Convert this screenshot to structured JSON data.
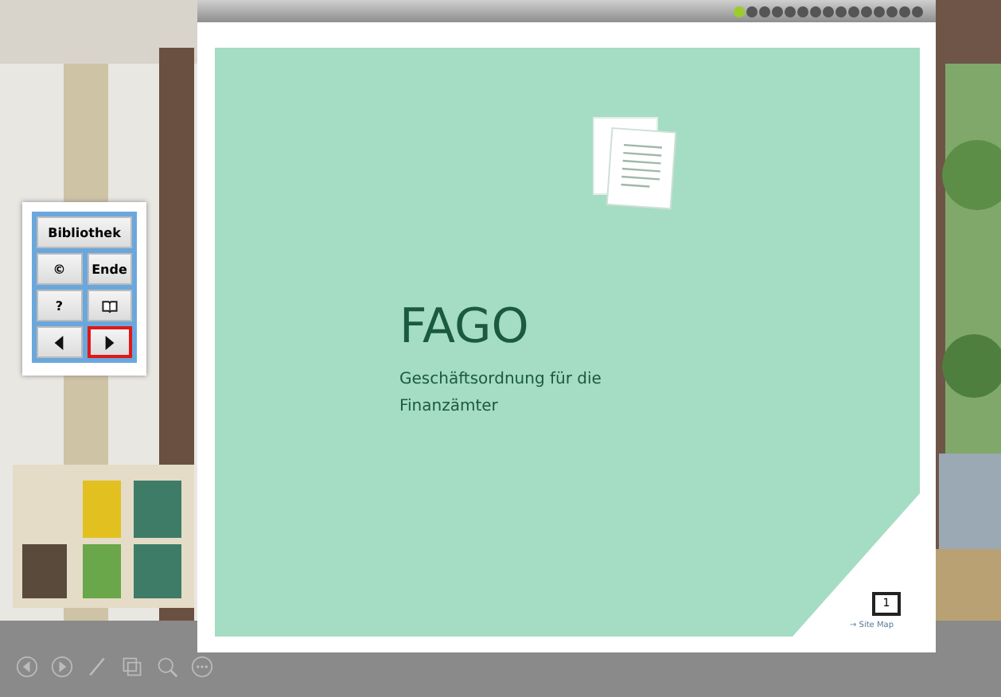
{
  "progress": {
    "dots": [
      {
        "selected": true
      },
      {
        "selected": false
      },
      {
        "selected": false
      },
      {
        "selected": false
      },
      {
        "selected": false
      },
      {
        "selected": false
      },
      {
        "selected": false
      },
      {
        "selected": false
      },
      {
        "selected": false
      },
      {
        "selected": false
      },
      {
        "selected": false
      },
      {
        "selected": false
      },
      {
        "selected": false
      },
      {
        "selected": false
      },
      {
        "selected": false
      }
    ]
  },
  "nav_panel": {
    "buttons": [
      {
        "kind": "text",
        "label": "Bibliothek",
        "wide": true,
        "highlighted": false
      },
      {
        "kind": "text",
        "label": "©",
        "wide": false,
        "highlighted": false
      },
      {
        "kind": "text",
        "label": "Ende",
        "wide": false,
        "highlighted": false
      },
      {
        "kind": "text",
        "label": "?",
        "wide": false,
        "highlighted": false
      },
      {
        "kind": "book",
        "wide": false,
        "highlighted": false
      },
      {
        "kind": "prev",
        "wide": false,
        "highlighted": false
      },
      {
        "kind": "next",
        "wide": false,
        "highlighted": true
      }
    ]
  },
  "slide": {
    "title": "FAGO",
    "subtitle": "Geschäftsordnung für die Finanzämter",
    "page_number": "1",
    "site_map_link": "→ Site Map"
  },
  "toolbar": {
    "tools": [
      {
        "kind": "back"
      },
      {
        "kind": "play"
      },
      {
        "kind": "pen"
      },
      {
        "kind": "copy"
      },
      {
        "kind": "zoom"
      },
      {
        "kind": "more"
      }
    ]
  }
}
